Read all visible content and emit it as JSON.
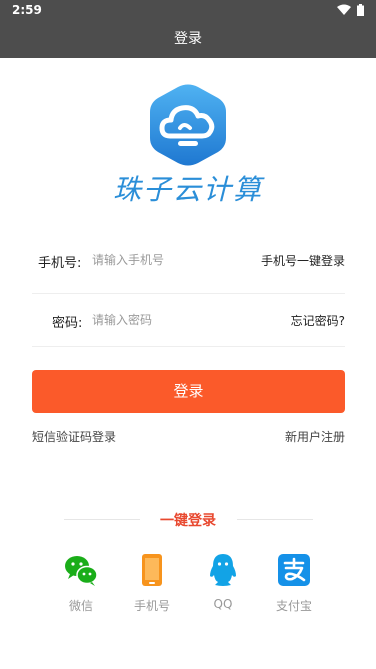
{
  "status_bar": {
    "time": "2:59"
  },
  "header": {
    "title": "登录"
  },
  "brand": {
    "name": "珠子云计算",
    "accent": "#2a8ed8"
  },
  "form": {
    "phone": {
      "label": "手机号:",
      "placeholder": "请输入手机号",
      "action": "手机号一键登录"
    },
    "password": {
      "label": "密码:",
      "placeholder": "请输入密码",
      "action": "忘记密码?"
    },
    "submit_label": "登录",
    "sms_login": "短信验证码登录",
    "register": "新用户注册",
    "submit_color": "#fb5a2a"
  },
  "quick_login": {
    "title": "一键登录",
    "items": [
      {
        "label": "微信",
        "icon": "wechat-icon"
      },
      {
        "label": "手机号",
        "icon": "phone-icon"
      },
      {
        "label": "QQ",
        "icon": "qq-icon"
      },
      {
        "label": "支付宝",
        "icon": "alipay-icon"
      }
    ]
  }
}
